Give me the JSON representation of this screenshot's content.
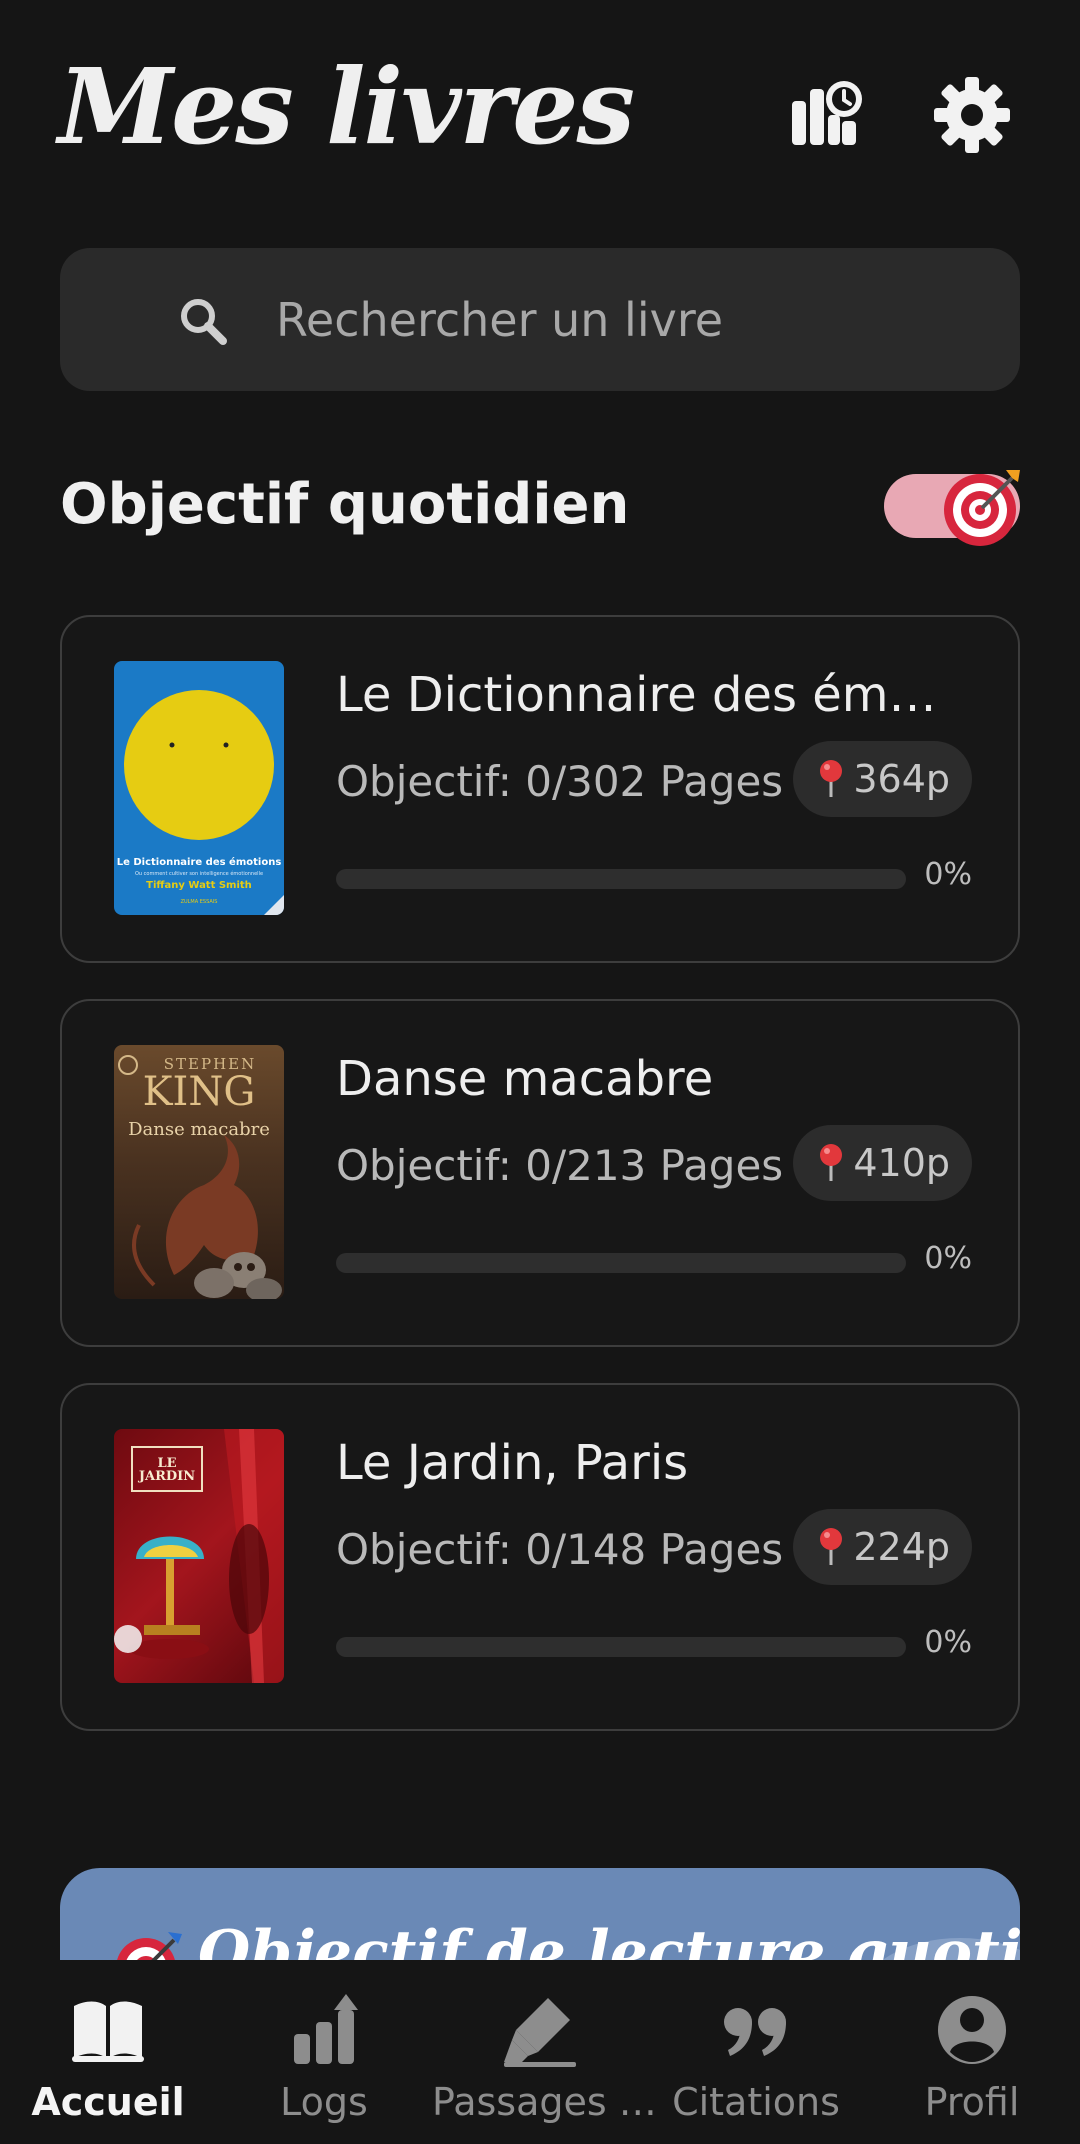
{
  "header": {
    "title": "Mes livres"
  },
  "search": {
    "placeholder": "Rechercher un livre"
  },
  "daily_goal": {
    "title": "Objectif quotidien",
    "toggle_on": true
  },
  "books": [
    {
      "title": "Le Dictionnaire des ém…",
      "goal": "Objectif: 0/302 Pages",
      "position": "364p",
      "progress_label": "0%",
      "progress": 0
    },
    {
      "title": "Danse macabre",
      "goal": "Objectif: 0/213 Pages",
      "position": "410p",
      "progress_label": "0%",
      "progress": 0
    },
    {
      "title": "Le Jardin, Paris",
      "goal": "Objectif: 0/148 Pages",
      "position": "224p",
      "progress_label": "0%",
      "progress": 0
    }
  ],
  "covers": {
    "dictionnaire": {
      "line1": "Le Dictionnaire des émotions",
      "line2": "Ou comment cultiver son intelligence émotionnelle",
      "author": "Tiffany Watt Smith",
      "publisher": "ZULMA ESSAIS"
    },
    "macabre": {
      "author_first": "STEPHEN",
      "author_last": "KING",
      "title": "Danse macabre"
    },
    "jardin": {
      "title": "LE JARDIN"
    }
  },
  "banner": {
    "text": "Objectif de lecture quotidien"
  },
  "nav": [
    {
      "label": "Accueil",
      "icon": "book-open-icon",
      "active": true
    },
    {
      "label": "Logs",
      "icon": "bar-chart-icon",
      "active": false
    },
    {
      "label": "Passages …",
      "icon": "highlighter-icon",
      "active": false
    },
    {
      "label": "Citations",
      "icon": "quote-icon",
      "active": false
    },
    {
      "label": "Profil",
      "icon": "user-circle-icon",
      "active": false
    }
  ],
  "colors": {
    "background": "#151515",
    "card_border": "#3d3d3d",
    "toggle": "#e8a8b4",
    "banner": "#6a89b6",
    "target_red": "#d7263d"
  }
}
